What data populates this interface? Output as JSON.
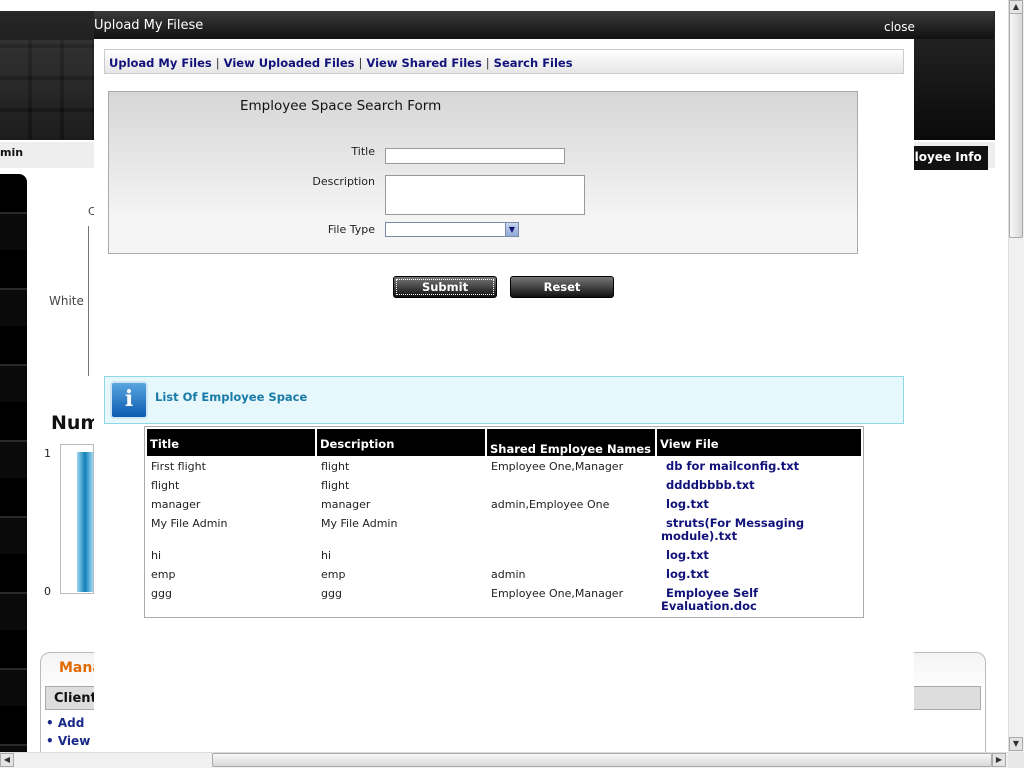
{
  "modal": {
    "title": "Upload My Filese",
    "close_label": "close",
    "tabs": [
      "Upload My Files",
      "View Uploaded Files",
      "View Shared Files",
      "Search Files"
    ],
    "tab_separator": "|"
  },
  "search_form": {
    "heading": "Employee Space Search Form",
    "title_label": "Title",
    "title_value": "",
    "description_label": "Description",
    "description_value": "",
    "file_type_label": "File Type",
    "file_type_selected": "",
    "submit_label": "Submit",
    "reset_label": "Reset"
  },
  "list": {
    "heading": "List Of Employee Space",
    "columns": [
      "Title",
      "Description",
      "Shared Employee Names",
      "View File"
    ],
    "rows": [
      {
        "title": "First flight",
        "description": "flight",
        "shared": "Employee One,Manager",
        "file": "db for mailconfig.txt"
      },
      {
        "title": "flight",
        "description": "flight",
        "shared": "",
        "file": "ddddbbbb.txt"
      },
      {
        "title": "manager",
        "description": "manager",
        "shared": "admin,Employee One",
        "file": "log.txt"
      },
      {
        "title": "My File Admin",
        "description": "My File Admin",
        "shared": "",
        "file": "struts(For Messaging module).txt"
      },
      {
        "title": "hi",
        "description": "hi",
        "shared": "",
        "file": "log.txt"
      },
      {
        "title": "emp",
        "description": "emp",
        "shared": "admin",
        "file": "log.txt"
      },
      {
        "title": "ggg",
        "description": "ggg",
        "shared": "Employee One,Manager",
        "file": "Employee Self Evaluation.doc"
      }
    ]
  },
  "background": {
    "admin_text": "min",
    "employee_info": "ployee Info",
    "chart_label": "White",
    "chart_top_tick": "C",
    "num_heading": "Num",
    "axis_one": "1",
    "axis_zero": "0",
    "panel_heading": "Mana",
    "client_heading": "Client",
    "list_items": [
      "Add",
      "View"
    ]
  },
  "colors": {
    "link": "#12137a",
    "info_text": "#1a7aa8",
    "header_bg": "#000000",
    "accent_orange": "#e06a00"
  }
}
